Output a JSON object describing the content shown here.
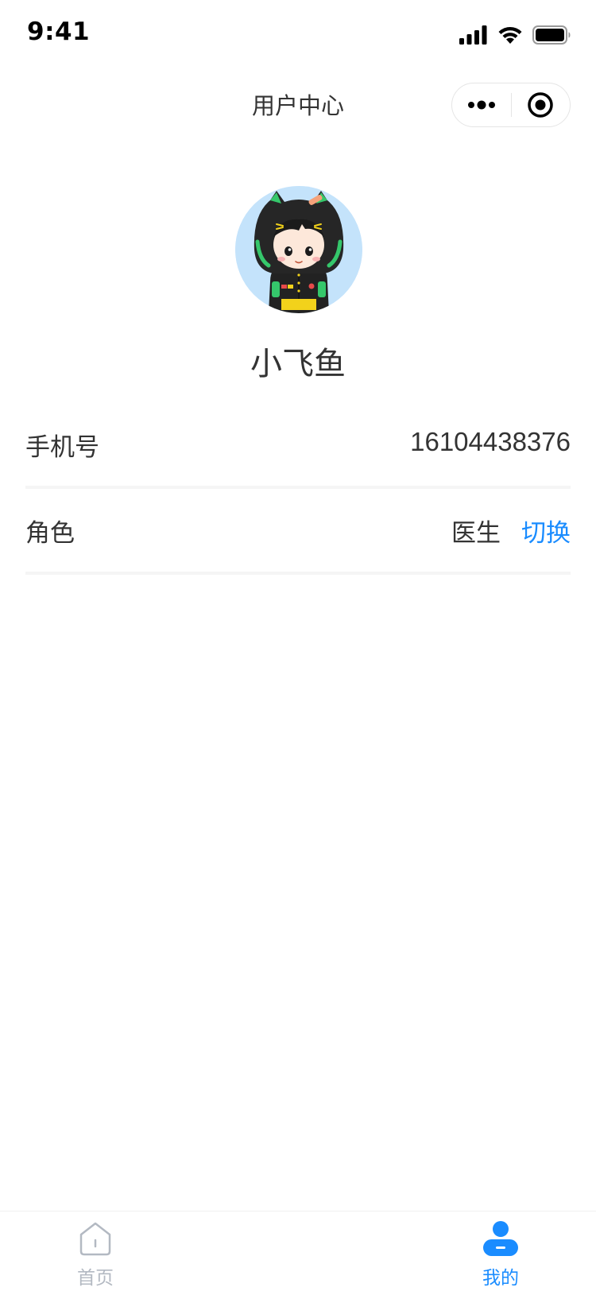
{
  "status_bar": {
    "time": "9:41"
  },
  "nav": {
    "title": "用户中心",
    "more_icon": "more-dots-icon",
    "close_icon": "target-circle-icon"
  },
  "profile": {
    "avatar": "cartoon-avatar",
    "name": "小飞鱼"
  },
  "info": {
    "phone": {
      "label": "手机号",
      "value": "16104438376"
    },
    "role": {
      "label": "角色",
      "value": "医生",
      "switch_label": "切换"
    }
  },
  "tab_bar": {
    "tabs": [
      {
        "label": "首页",
        "icon": "home-icon",
        "active": false
      },
      {
        "label": "我的",
        "icon": "user-icon",
        "active": true
      }
    ]
  },
  "colors": {
    "accent": "#1a8cff",
    "inactive_tab": "#b3b9c2",
    "text": "#333333",
    "divider": "#f5f5f5"
  }
}
